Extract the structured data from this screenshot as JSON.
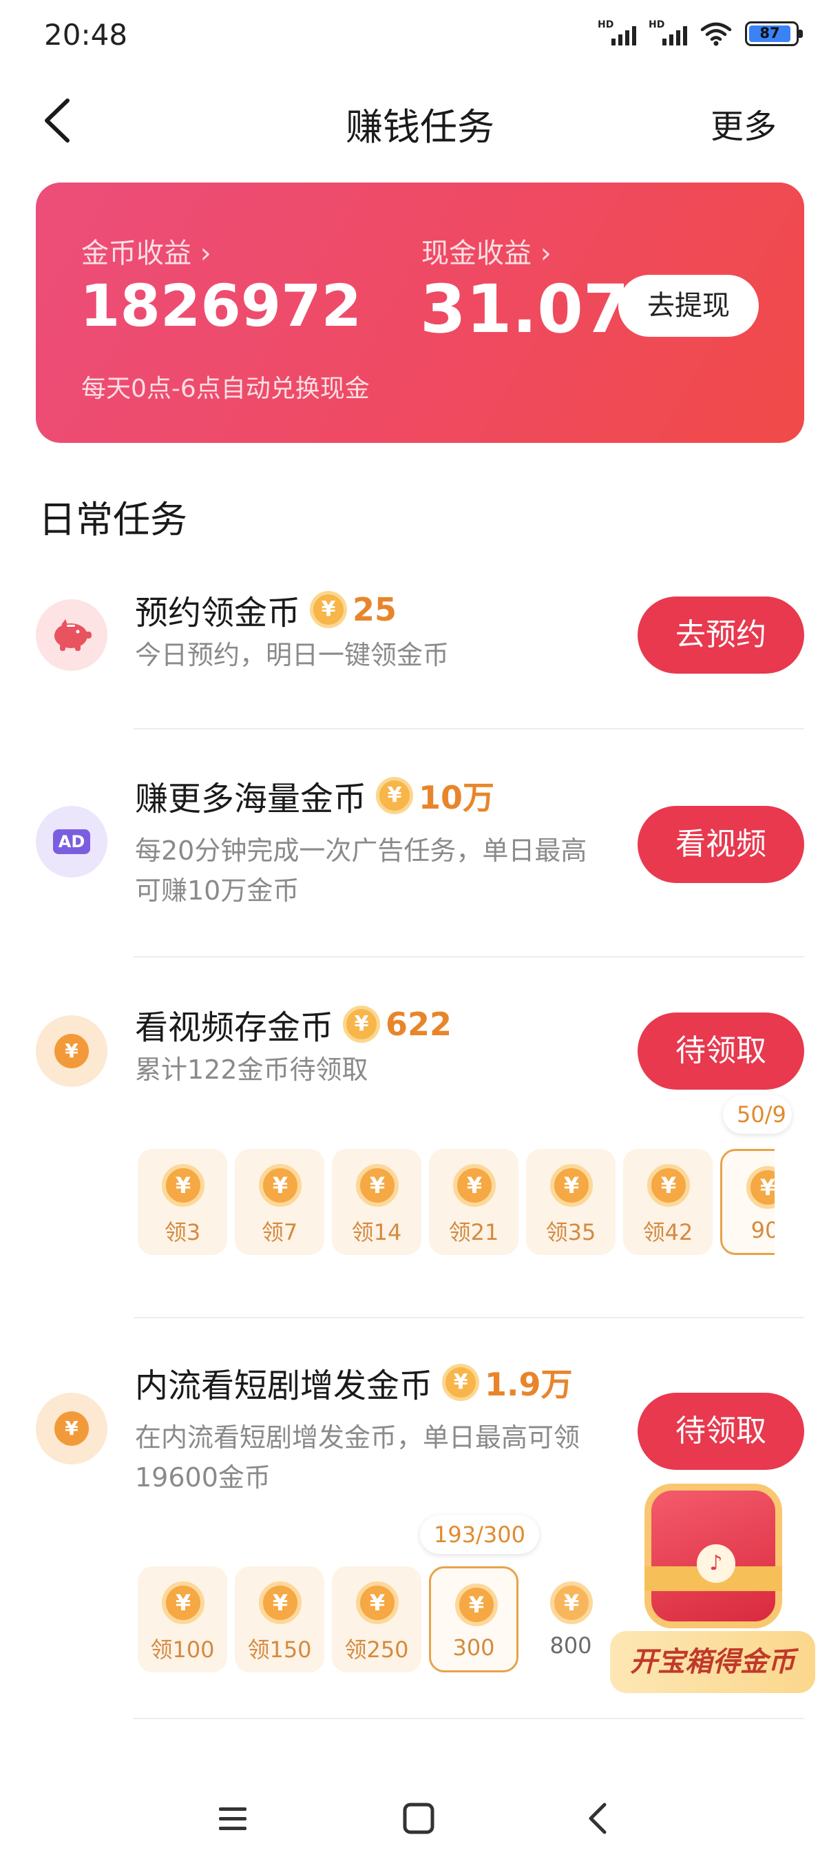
{
  "status_bar": {
    "time": "20:48",
    "battery": "87",
    "signal_label": "HD"
  },
  "nav": {
    "title": "赚钱任务",
    "more": "更多"
  },
  "earnings": {
    "coin_label": "金币收益 ›",
    "coin_value": "1826972",
    "cash_label": "现金收益 ›",
    "cash_value": "31.07",
    "withdraw_button": "去提现",
    "note": "每天0点-6点自动兑换现金"
  },
  "daily": {
    "title": "日常任务",
    "tasks": [
      {
        "title": "预约领金币",
        "reward": "25",
        "desc": "今日预约，明日一键领金币",
        "button": "去预约",
        "icon": "piggy-bank-icon"
      },
      {
        "title": "赚更多海量金币",
        "reward": "10万",
        "desc": "每20分钟完成一次广告任务，单日最高可赚10万金币",
        "button": "看视频",
        "icon": "ad-icon",
        "icon_text": "AD"
      },
      {
        "title": "看视频存金币",
        "reward": "622",
        "desc": "累计122金币待领取",
        "button": "待领取",
        "icon": "yuan-coin-icon",
        "progress": "50/9",
        "chips": [
          "领3",
          "领7",
          "领14",
          "领21",
          "领35",
          "领42",
          "90"
        ]
      },
      {
        "title": "内流看短剧增发金币",
        "reward": "1.9万",
        "desc": "在内流看短剧增发金币，单日最高可领19600金币",
        "button": "待领取",
        "icon": "yuan-coin-icon",
        "progress": "193/300",
        "chips": [
          "领100",
          "领150",
          "领250",
          "300",
          "800"
        ]
      }
    ]
  },
  "coin_glyph": "¥",
  "treasure": {
    "label": "开宝箱得金币"
  },
  "colors": {
    "accent": "#e8394f",
    "coin": "#f5a843",
    "reward_text": "#e8852b"
  }
}
